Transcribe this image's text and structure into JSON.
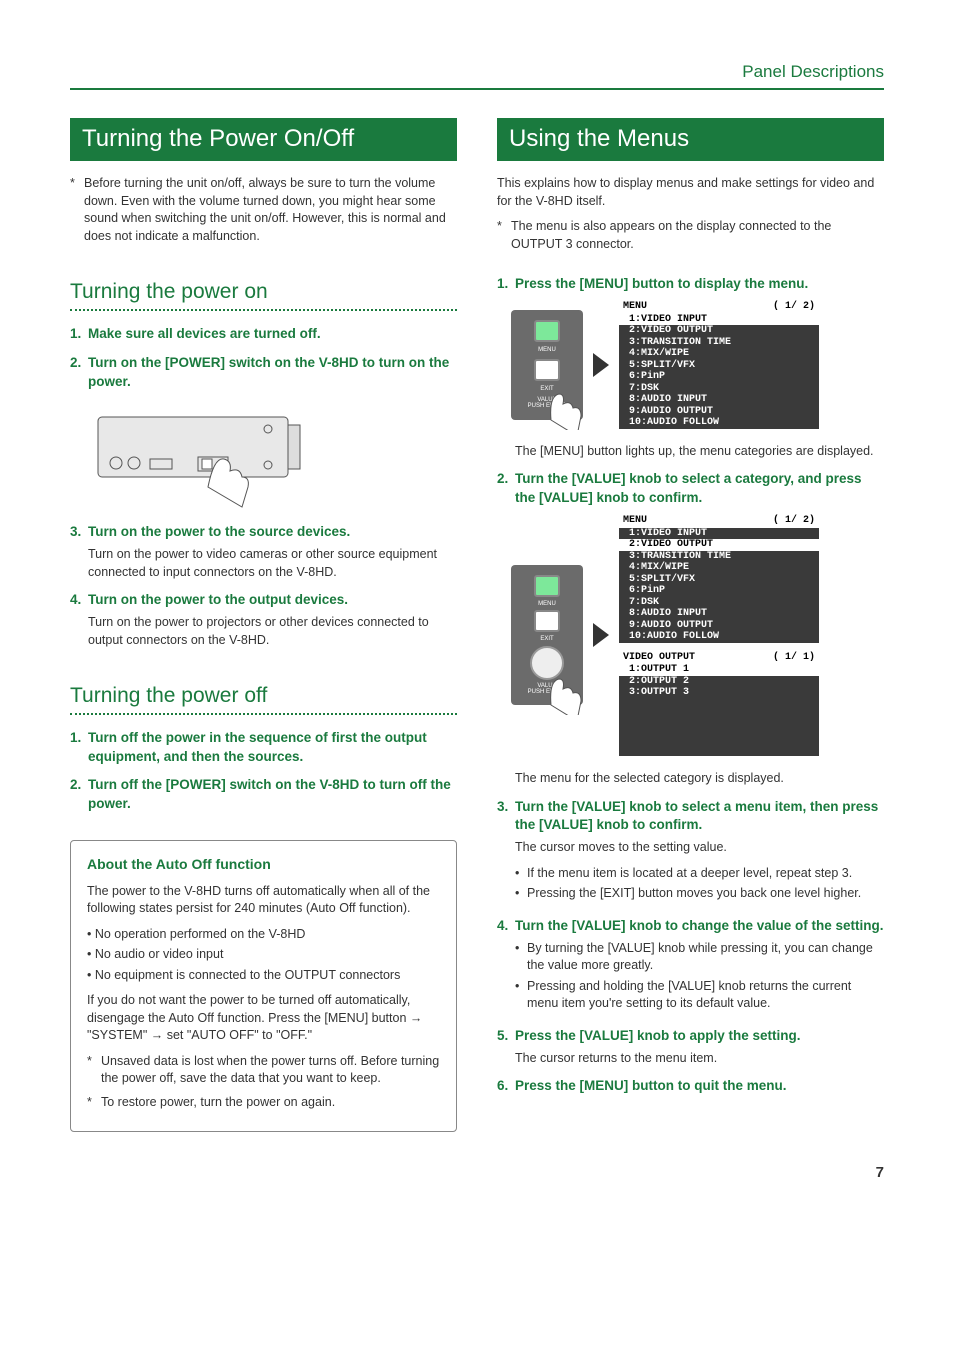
{
  "header": {
    "section_label": "Panel Descriptions"
  },
  "page_number": "7",
  "left": {
    "title": "Turning the Power On/Off",
    "top_note": "Before turning the unit on/off, always be sure to turn the volume down. Even with the volume turned down, you might hear some sound when switching the unit on/off. However, this is normal and does not indicate a malfunction.",
    "sub_on": "Turning the power on",
    "steps_on": [
      {
        "n": "1.",
        "t": "Make sure all devices are turned off."
      },
      {
        "n": "2.",
        "t": "Turn on the [POWER] switch on the V-8HD to turn on the power."
      },
      {
        "n": "3.",
        "t": "Turn on the power to the source devices.",
        "d": "Turn on the power to video cameras or other source equipment connected to input connectors on the V-8HD."
      },
      {
        "n": "4.",
        "t": "Turn on the power to the output devices.",
        "d": "Turn on the power to projectors or other devices connected to output connectors on the V-8HD."
      }
    ],
    "sub_off": "Turning the power off",
    "steps_off": [
      {
        "n": "1.",
        "t": "Turn off the power in the sequence of first the output equipment, and then the sources."
      },
      {
        "n": "2.",
        "t": "Turn off the [POWER] switch on the V-8HD to turn off the power."
      }
    ],
    "box": {
      "title": "About the Auto Off function",
      "intro": "The power to the V-8HD turns off automatically when all of the following states persist for 240 minutes (Auto Off function).",
      "bullets": [
        "No operation performed on the V-8HD",
        "No audio or video input",
        "No equipment is connected to the OUTPUT connectors"
      ],
      "para": "If you do not want the power to be turned off automatically, disengage the Auto Off function. Press the [MENU] button  →  \"SYSTEM\"  →  set \"AUTO OFF\" to \"OFF.\"",
      "notes": [
        "Unsaved data is lost when the power turns off. Before turning the power off, save the data that you want to keep.",
        "To restore power, turn the power on again."
      ]
    }
  },
  "right": {
    "title": "Using the Menus",
    "intro": "This explains how to display menus and make settings for video and for the V-8HD itself.",
    "top_note": "The menu is also appears on the display connected to the OUTPUT 3 connector.",
    "steps": [
      {
        "n": "1.",
        "t": "Press the [MENU] button to display the menu.",
        "after": "The [MENU] button lights up, the menu categories are displayed."
      },
      {
        "n": "2.",
        "t": "Turn the [VALUE] knob to select a category, and press the [VALUE] knob to confirm.",
        "after": "The menu for the selected category is displayed."
      },
      {
        "n": "3.",
        "t": "Turn the [VALUE] knob to select a menu item, then press the [VALUE] knob to confirm.",
        "d": "The cursor moves to the setting value.",
        "bullets": [
          "If the menu item is located at a deeper level, repeat step 3.",
          "Pressing the [EXIT] button moves you back one level higher."
        ]
      },
      {
        "n": "4.",
        "t": "Turn the [VALUE] knob to change the value of the setting.",
        "bullets": [
          "By turning the [VALUE] knob while pressing it, you can change the value more greatly.",
          "Pressing and holding the [VALUE] knob returns the current menu item you're setting to its default value."
        ]
      },
      {
        "n": "5.",
        "t": "Press the [VALUE] knob to apply the setting.",
        "d": "The cursor returns to the menu item."
      },
      {
        "n": "6.",
        "t": "Press the [MENU] button to quit the menu."
      }
    ],
    "panel_labels": {
      "menu": "MENU",
      "exit": "EXIT",
      "value": "VALUE\nPUSH ENTER"
    },
    "menu1": {
      "title": "MENU",
      "page": "( 1/ 2)",
      "items": [
        "1:VIDEO INPUT",
        "2:VIDEO OUTPUT",
        "3:TRANSITION TIME",
        "4:MIX/WIPE",
        "5:SPLIT/VFX",
        "6:PinP",
        "7:DSK",
        "8:AUDIO INPUT",
        "9:AUDIO OUTPUT",
        "10:AUDIO FOLLOW"
      ],
      "highlight": 0
    },
    "menu2": {
      "title": "MENU",
      "page": "( 1/ 2)",
      "items": [
        "1:VIDEO INPUT",
        "2:VIDEO OUTPUT",
        "3:TRANSITION TIME",
        "4:MIX/WIPE",
        "5:SPLIT/VFX",
        "6:PinP",
        "7:DSK",
        "8:AUDIO INPUT",
        "9:AUDIO OUTPUT",
        "10:AUDIO FOLLOW"
      ],
      "highlight": 1
    },
    "menu3": {
      "title": "VIDEO OUTPUT",
      "page": "( 1/ 1)",
      "items": [
        "1:OUTPUT 1",
        "2:OUTPUT 2",
        "3:OUTPUT 3"
      ],
      "highlight": 0
    }
  }
}
